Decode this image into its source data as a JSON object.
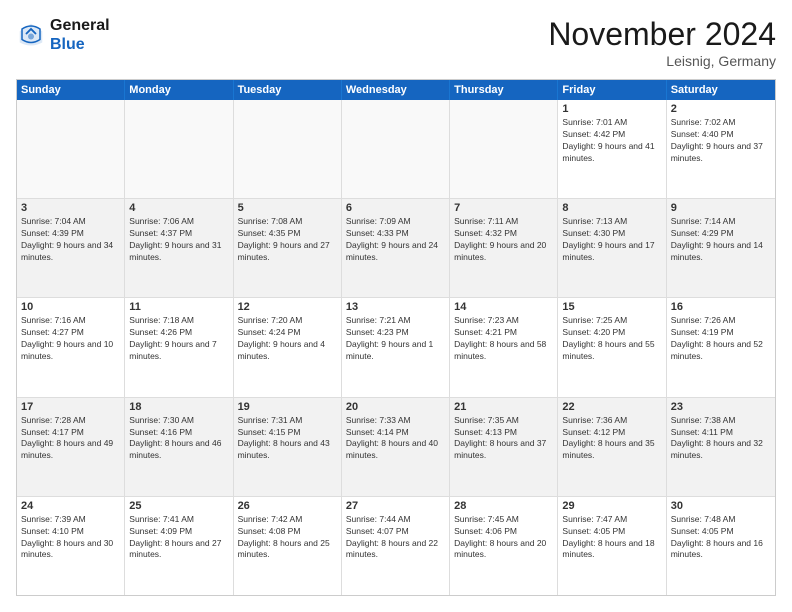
{
  "header": {
    "logo_line1": "General",
    "logo_line2": "Blue",
    "month_title": "November 2024",
    "subtitle": "Leisnig, Germany"
  },
  "days_of_week": [
    "Sunday",
    "Monday",
    "Tuesday",
    "Wednesday",
    "Thursday",
    "Friday",
    "Saturday"
  ],
  "rows": [
    [
      {
        "day": "",
        "text": ""
      },
      {
        "day": "",
        "text": ""
      },
      {
        "day": "",
        "text": ""
      },
      {
        "day": "",
        "text": ""
      },
      {
        "day": "",
        "text": ""
      },
      {
        "day": "1",
        "text": "Sunrise: 7:01 AM\nSunset: 4:42 PM\nDaylight: 9 hours and 41 minutes."
      },
      {
        "day": "2",
        "text": "Sunrise: 7:02 AM\nSunset: 4:40 PM\nDaylight: 9 hours and 37 minutes."
      }
    ],
    [
      {
        "day": "3",
        "text": "Sunrise: 7:04 AM\nSunset: 4:39 PM\nDaylight: 9 hours and 34 minutes."
      },
      {
        "day": "4",
        "text": "Sunrise: 7:06 AM\nSunset: 4:37 PM\nDaylight: 9 hours and 31 minutes."
      },
      {
        "day": "5",
        "text": "Sunrise: 7:08 AM\nSunset: 4:35 PM\nDaylight: 9 hours and 27 minutes."
      },
      {
        "day": "6",
        "text": "Sunrise: 7:09 AM\nSunset: 4:33 PM\nDaylight: 9 hours and 24 minutes."
      },
      {
        "day": "7",
        "text": "Sunrise: 7:11 AM\nSunset: 4:32 PM\nDaylight: 9 hours and 20 minutes."
      },
      {
        "day": "8",
        "text": "Sunrise: 7:13 AM\nSunset: 4:30 PM\nDaylight: 9 hours and 17 minutes."
      },
      {
        "day": "9",
        "text": "Sunrise: 7:14 AM\nSunset: 4:29 PM\nDaylight: 9 hours and 14 minutes."
      }
    ],
    [
      {
        "day": "10",
        "text": "Sunrise: 7:16 AM\nSunset: 4:27 PM\nDaylight: 9 hours and 10 minutes."
      },
      {
        "day": "11",
        "text": "Sunrise: 7:18 AM\nSunset: 4:26 PM\nDaylight: 9 hours and 7 minutes."
      },
      {
        "day": "12",
        "text": "Sunrise: 7:20 AM\nSunset: 4:24 PM\nDaylight: 9 hours and 4 minutes."
      },
      {
        "day": "13",
        "text": "Sunrise: 7:21 AM\nSunset: 4:23 PM\nDaylight: 9 hours and 1 minute."
      },
      {
        "day": "14",
        "text": "Sunrise: 7:23 AM\nSunset: 4:21 PM\nDaylight: 8 hours and 58 minutes."
      },
      {
        "day": "15",
        "text": "Sunrise: 7:25 AM\nSunset: 4:20 PM\nDaylight: 8 hours and 55 minutes."
      },
      {
        "day": "16",
        "text": "Sunrise: 7:26 AM\nSunset: 4:19 PM\nDaylight: 8 hours and 52 minutes."
      }
    ],
    [
      {
        "day": "17",
        "text": "Sunrise: 7:28 AM\nSunset: 4:17 PM\nDaylight: 8 hours and 49 minutes."
      },
      {
        "day": "18",
        "text": "Sunrise: 7:30 AM\nSunset: 4:16 PM\nDaylight: 8 hours and 46 minutes."
      },
      {
        "day": "19",
        "text": "Sunrise: 7:31 AM\nSunset: 4:15 PM\nDaylight: 8 hours and 43 minutes."
      },
      {
        "day": "20",
        "text": "Sunrise: 7:33 AM\nSunset: 4:14 PM\nDaylight: 8 hours and 40 minutes."
      },
      {
        "day": "21",
        "text": "Sunrise: 7:35 AM\nSunset: 4:13 PM\nDaylight: 8 hours and 37 minutes."
      },
      {
        "day": "22",
        "text": "Sunrise: 7:36 AM\nSunset: 4:12 PM\nDaylight: 8 hours and 35 minutes."
      },
      {
        "day": "23",
        "text": "Sunrise: 7:38 AM\nSunset: 4:11 PM\nDaylight: 8 hours and 32 minutes."
      }
    ],
    [
      {
        "day": "24",
        "text": "Sunrise: 7:39 AM\nSunset: 4:10 PM\nDaylight: 8 hours and 30 minutes."
      },
      {
        "day": "25",
        "text": "Sunrise: 7:41 AM\nSunset: 4:09 PM\nDaylight: 8 hours and 27 minutes."
      },
      {
        "day": "26",
        "text": "Sunrise: 7:42 AM\nSunset: 4:08 PM\nDaylight: 8 hours and 25 minutes."
      },
      {
        "day": "27",
        "text": "Sunrise: 7:44 AM\nSunset: 4:07 PM\nDaylight: 8 hours and 22 minutes."
      },
      {
        "day": "28",
        "text": "Sunrise: 7:45 AM\nSunset: 4:06 PM\nDaylight: 8 hours and 20 minutes."
      },
      {
        "day": "29",
        "text": "Sunrise: 7:47 AM\nSunset: 4:05 PM\nDaylight: 8 hours and 18 minutes."
      },
      {
        "day": "30",
        "text": "Sunrise: 7:48 AM\nSunset: 4:05 PM\nDaylight: 8 hours and 16 minutes."
      }
    ]
  ]
}
